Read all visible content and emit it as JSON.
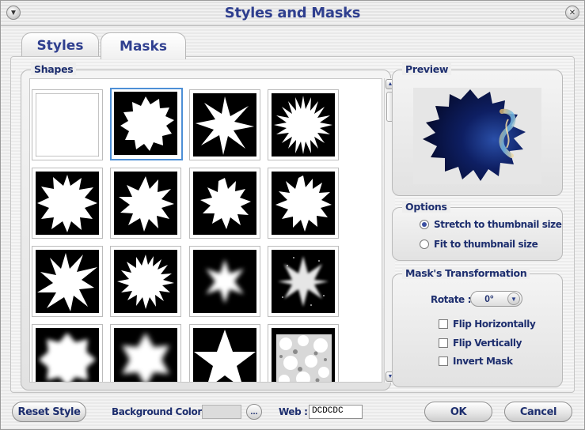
{
  "window": {
    "title": "Styles and Masks"
  },
  "tabs": [
    {
      "label": "Styles",
      "active": false
    },
    {
      "label": "Masks",
      "active": true
    }
  ],
  "shapes": {
    "label": "Shapes",
    "selected_index": 1,
    "items": [
      {
        "name": "blank"
      },
      {
        "name": "star-burst-rough"
      },
      {
        "name": "star-8-point"
      },
      {
        "name": "sun-burst"
      },
      {
        "name": "star-jagged"
      },
      {
        "name": "star-spiky"
      },
      {
        "name": "splat"
      },
      {
        "name": "splat-round"
      },
      {
        "name": "splash"
      },
      {
        "name": "sun-burst-spiky"
      },
      {
        "name": "star-soft-glow"
      },
      {
        "name": "star-spray"
      },
      {
        "name": "flower-blur"
      },
      {
        "name": "star-6-blur"
      },
      {
        "name": "star-5-point"
      },
      {
        "name": "texture-splotch"
      }
    ]
  },
  "preview": {
    "label": "Preview"
  },
  "options": {
    "label": "Options",
    "radios": [
      {
        "label": "Stretch to thumbnail size",
        "checked": true
      },
      {
        "label": "Fit to thumbnail size",
        "checked": false
      }
    ]
  },
  "transform": {
    "label": "Mask's Transformation",
    "rotate_label": "Rotate :",
    "rotate_value": "0°",
    "checks": [
      {
        "label": "Flip Horizontally",
        "checked": false
      },
      {
        "label": "Flip Vertically",
        "checked": false
      },
      {
        "label": "Invert Mask",
        "checked": false
      }
    ]
  },
  "footer": {
    "reset_label": "Reset Style",
    "bg_color_label": "Background Color :",
    "bg_color": "#DCDCDC",
    "dots_label": "...",
    "web_label": "Web :",
    "web_value": "DCDCDC",
    "ok_label": "OK",
    "cancel_label": "Cancel"
  },
  "colors": {
    "accent": "#2f3f8f",
    "text": "#1d2e6e",
    "selection": "#4d8fd6"
  }
}
